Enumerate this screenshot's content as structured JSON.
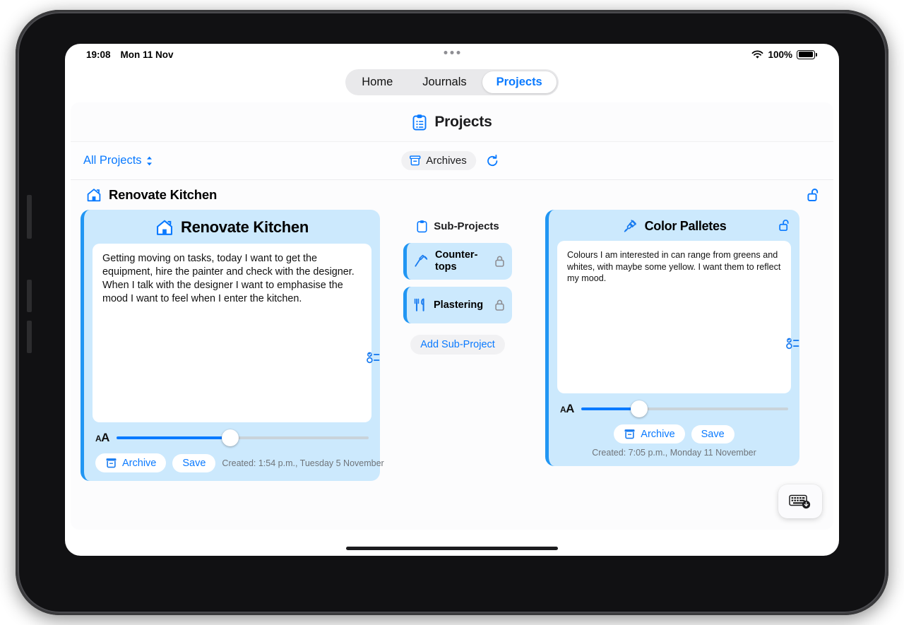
{
  "status_bar": {
    "time": "19:08",
    "date": "Mon 11 Nov",
    "battery_percent": "100%",
    "wifi_icon": "wifi-icon",
    "battery_icon": "battery-full-icon"
  },
  "tabs": [
    {
      "label": "Home",
      "selected": false
    },
    {
      "label": "Journals",
      "selected": false
    },
    {
      "label": "Projects",
      "selected": true
    }
  ],
  "page": {
    "title": "Projects",
    "title_icon": "clipboard-list-icon"
  },
  "toolbar": {
    "filter_label": "All Projects",
    "filter_icon": "chevron-up-down-icon",
    "archives_label": "Archives",
    "archives_icon": "archive-box-icon",
    "refresh_icon": "refresh-circle-icon"
  },
  "project_header": {
    "title": "Renovate Kitchen",
    "icon": "house-icon",
    "lock_icon": "lock-open-icon"
  },
  "left_card": {
    "title": "Renovate Kitchen",
    "icon": "house-icon",
    "body": "Getting moving on tasks, today I want to get the equipment, hire the painter and check with the designer. When I talk with the designer I want to emphasise the mood I want to feel when I enter the kitchen.",
    "list_icon": "checklist-icon",
    "slider": {
      "label_small": "A",
      "label_big": "A",
      "value_percent": 45
    },
    "archive_label": "Archive",
    "archive_icon": "archive-box-icon",
    "save_label": "Save",
    "created_text": "Created: 1:54 p.m., Tuesday 5 November"
  },
  "sub_projects": {
    "title": "Sub-Projects",
    "title_icon": "clipboard-icon",
    "items": [
      {
        "label": "Counter-tops",
        "icon": "hammer-icon",
        "lock_icon": "lock-closed-icon"
      },
      {
        "label": "Plastering",
        "icon": "utensils-icon",
        "lock_icon": "lock-closed-icon"
      }
    ],
    "add_label": "Add Sub-Project"
  },
  "right_card": {
    "title": "Color Palletes",
    "icon": "paintbrush-icon",
    "lock_icon": "lock-open-icon",
    "body": "Colours I am interested in can range from greens and whites, with maybe some yellow. I want them to reflect my mood.",
    "list_icon": "checklist-icon",
    "slider": {
      "label_small": "A",
      "label_big": "A",
      "value_percent": 28
    },
    "archive_label": "Archive",
    "archive_icon": "archive-box-icon",
    "save_label": "Save",
    "created_text": "Created: 7:05 p.m., Monday 11 November"
  },
  "floating": {
    "keyboard_dismiss_icon": "keyboard-dismiss-icon"
  },
  "colors": {
    "accent_blue": "#0a7aff",
    "card_blue_bg": "#cce9fd",
    "card_blue_border": "#2196f3",
    "track_gray": "#e9e9eb"
  }
}
